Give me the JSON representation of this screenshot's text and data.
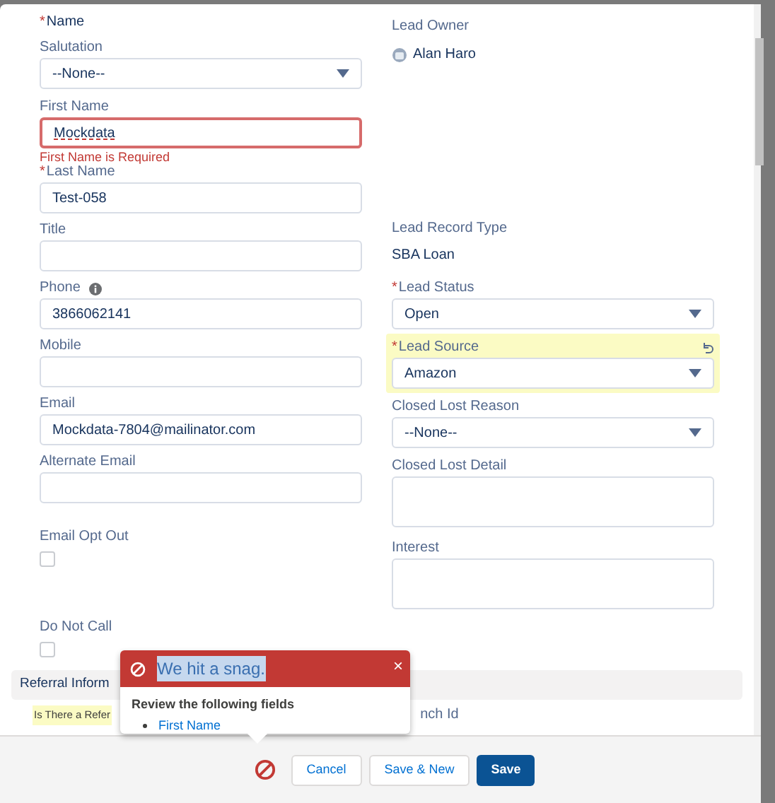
{
  "section_title": {
    "label": "Name",
    "required_mark": "*"
  },
  "left_fields": [
    {
      "kind": "select",
      "label": "Salutation",
      "value": "--None--"
    },
    {
      "kind": "input",
      "label": "First Name",
      "value": "Mockdata",
      "error": "First Name is Required"
    },
    {
      "kind": "input",
      "label": "Last Name",
      "required_mark": "*",
      "value": "Test-058"
    },
    {
      "kind": "input",
      "label": "Title"
    },
    {
      "kind": "input",
      "label": "Phone",
      "value": "3866062141",
      "info": true
    },
    {
      "kind": "input",
      "label": "Mobile"
    },
    {
      "kind": "input",
      "label": "Email",
      "value": "Mockdata-7804@mailinator.com"
    },
    {
      "kind": "input",
      "label": "Alternate Email"
    },
    {
      "kind": "checkbox",
      "label": "Email Opt Out",
      "checked": false
    },
    {
      "kind": "checkbox",
      "label": "Do Not Call",
      "checked": false
    }
  ],
  "right_fields": [
    {
      "kind": "owner",
      "label": "Lead Owner",
      "value": "Alan Haro"
    },
    {
      "kind": "text",
      "label": "Lead Record Type",
      "value": "SBA Loan"
    },
    {
      "kind": "select",
      "label": "Lead Status",
      "required_mark": "*",
      "value": "Open",
      "highlighted": false
    },
    {
      "kind": "select",
      "label": "Lead Source",
      "required_mark": "*",
      "value": "Amazon",
      "highlighted": true
    },
    {
      "kind": "select",
      "label": "Closed Lost Reason",
      "value": "--None--",
      "highlighted": false
    },
    {
      "kind": "textarea",
      "label": "Closed Lost Detail"
    },
    {
      "kind": "textarea",
      "label": "Interest"
    }
  ],
  "section": {
    "title": "Referral Inform",
    "left_label": "Is There a Refer",
    "right_label": "nch Id"
  },
  "error_popover": {
    "title": "We hit a snag.",
    "subtitle": "Review the following fields",
    "fields": [
      "First Name"
    ],
    "close": "×"
  },
  "footer": {
    "buttons": [
      {
        "label": "Cancel",
        "kind": "neutral"
      },
      {
        "label": "Save & New",
        "kind": "neutral"
      },
      {
        "label": "Save",
        "kind": "brand"
      }
    ]
  }
}
